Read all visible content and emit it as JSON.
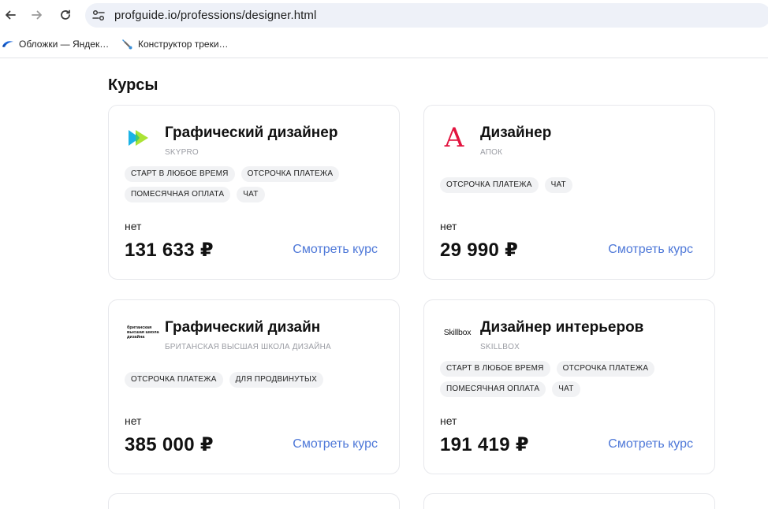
{
  "browser": {
    "url": "profguide.io/professions/designer.html",
    "bookmarks": [
      {
        "label": "Обложки — Яндек…",
        "icon": "yandex-blue-icon"
      },
      {
        "label": "Конструктор треки…",
        "icon": "tool-icon"
      }
    ]
  },
  "page": {
    "section_title": "Курсы",
    "cards": [
      {
        "title": "Графический дизайнер",
        "school": "SKYPRO",
        "logo": "skypro-logo",
        "tags": [
          "СТАРТ В ЛЮБОЕ ВРЕМЯ",
          "ОТСРОЧКА ПЛАТЕЖА",
          "ПОМЕСЯЧНАЯ ОПЛАТА",
          "ЧАТ"
        ],
        "net": "нет",
        "price": "131 633 ₽",
        "link": "Смотреть курс"
      },
      {
        "title": "Дизайнер",
        "school": "АПОК",
        "logo": "apok-logo",
        "logo_text": "A",
        "tags": [
          "ОТСРОЧКА ПЛАТЕЖА",
          "ЧАТ"
        ],
        "net": "нет",
        "price": "29 990 ₽",
        "link": "Смотреть курс"
      },
      {
        "title": "Графический дизайн",
        "school": "БРИТАНСКАЯ ВЫСШАЯ ШКОЛА ДИЗАЙНА",
        "logo": "bhsad-logo",
        "logo_text": "британская высшая школа дизайна",
        "tags": [
          "ОТСРОЧКА ПЛАТЕЖА",
          "ДЛЯ ПРОДВИНУТЫХ"
        ],
        "net": "нет",
        "price": "385 000 ₽",
        "link": "Смотреть курс"
      },
      {
        "title": "Дизайнер интерьеров",
        "school": "SKILLBOX",
        "logo": "skillbox-logo",
        "logo_text": "Skillbox",
        "tags": [
          "СТАРТ В ЛЮБОЕ ВРЕМЯ",
          "ОТСРОЧКА ПЛАТЕЖА",
          "ПОМЕСЯЧНАЯ ОПЛАТА",
          "ЧАТ"
        ],
        "net": "нет",
        "price": "191 419 ₽",
        "link": "Смотреть курс"
      }
    ]
  },
  "colors": {
    "link": "#4e78d8",
    "tag_bg": "#f1f2f4",
    "apok_red": "#e2143f",
    "skypro_green": "#a6e22a",
    "skypro_blue": "#1bb3e6"
  }
}
